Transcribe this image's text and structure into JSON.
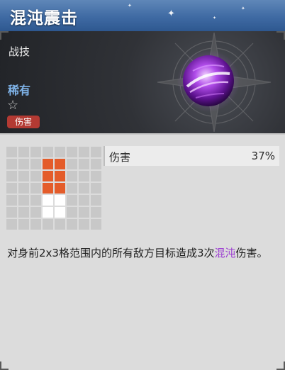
{
  "header": {
    "title": "混沌震击"
  },
  "skill": {
    "type": "战技",
    "rarity": "稀有",
    "tag": "伤害"
  },
  "range_grid": {
    "columns": 8,
    "rows": 7,
    "hit_cells": [
      [
        1,
        3
      ],
      [
        1,
        4
      ],
      [
        2,
        3
      ],
      [
        2,
        4
      ],
      [
        3,
        3
      ],
      [
        3,
        4
      ]
    ],
    "self_cells": [
      [
        4,
        3
      ],
      [
        4,
        4
      ],
      [
        5,
        3
      ],
      [
        5,
        4
      ]
    ]
  },
  "stats": [
    {
      "label": "伤害",
      "value": "37%"
    }
  ],
  "description": {
    "before": "对身前2x3格范围内的所有敌方目标造成3次",
    "highlight": "混沌",
    "after": "伤害。"
  },
  "colors": {
    "title_bar": "#3f6aa3",
    "rarity": "#7fb3e8",
    "tag": "#b33a33",
    "hit": "#e45c2a",
    "highlight": "#9b3bd1"
  },
  "icons": {
    "skill_icon": "purple-chaos-orb-icon",
    "rarity_star": "star-outline-icon"
  }
}
